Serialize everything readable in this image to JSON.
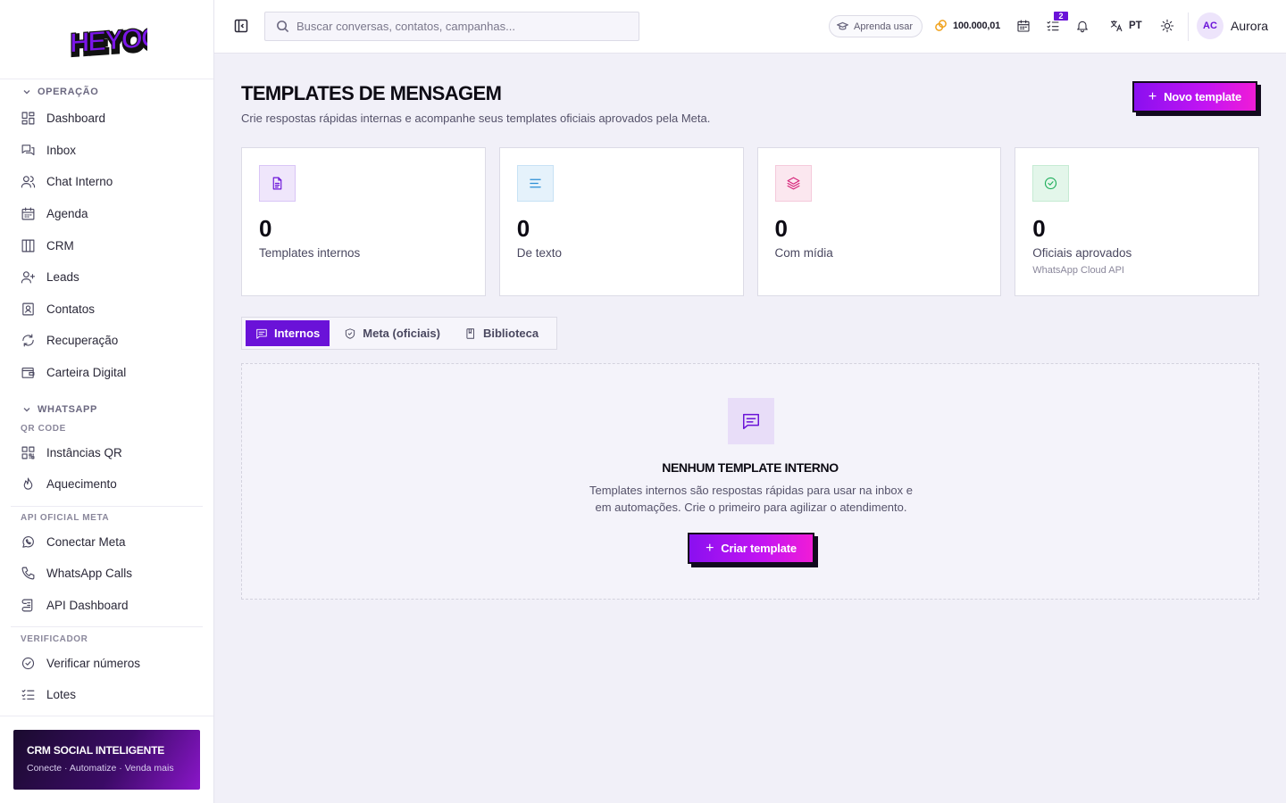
{
  "sidebar": {
    "logo_text": "HEYOO",
    "groups": [
      {
        "label": "OPERAÇÃO",
        "items": [
          {
            "label": "Dashboard",
            "icon": "dashboard-icon"
          },
          {
            "label": "Inbox",
            "icon": "inbox-icon"
          },
          {
            "label": "Chat Interno",
            "icon": "users-icon"
          },
          {
            "label": "Agenda",
            "icon": "calendar-icon"
          },
          {
            "label": "CRM",
            "icon": "columns-icon"
          },
          {
            "label": "Leads",
            "icon": "user-plus-icon"
          },
          {
            "label": "Contatos",
            "icon": "contact-icon"
          },
          {
            "label": "Recuperação",
            "icon": "refresh-icon"
          },
          {
            "label": "Carteira Digital",
            "icon": "wallet-icon"
          }
        ]
      },
      {
        "label": "WHATSAPP"
      }
    ],
    "qr_head": "QR CODE",
    "qr_items": [
      {
        "label": "Instâncias QR",
        "icon": "qr-icon"
      },
      {
        "label": "Aquecimento",
        "icon": "flame-icon"
      }
    ],
    "meta_head": "API OFICIAL META",
    "meta_items": [
      {
        "label": "Conectar Meta",
        "icon": "whatsapp-icon"
      },
      {
        "label": "WhatsApp Calls",
        "icon": "phone-icon"
      },
      {
        "label": "API Dashboard",
        "icon": "scroll-icon"
      }
    ],
    "verif_head": "VERIFICADOR",
    "verif_items": [
      {
        "label": "Verificar números",
        "icon": "check-circle-icon"
      },
      {
        "label": "Lotes",
        "icon": "list-check-icon"
      }
    ],
    "promo": {
      "title": "CRM SOCIAL INTELIGENTE",
      "subtitle": "Conecte · Automatize · Venda mais"
    }
  },
  "topbar": {
    "search_placeholder": "Buscar conversas, contatos, campanhas...",
    "learn_label": "Aprenda usar",
    "credits": "100.000,01",
    "tasks_badge": "2",
    "language": "PT",
    "avatar_initials": "AC",
    "username": "Aurora"
  },
  "page": {
    "title": "TEMPLATES DE MENSAGEM",
    "subtitle": "Crie respostas rápidas internas e acompanhe seus templates oficiais aprovados pela Meta.",
    "new_button": "Novo template"
  },
  "stats": [
    {
      "value": "0",
      "label": "Templates internos",
      "note": "",
      "icon": "file-text-icon",
      "color": "#6a12d8",
      "bg": "#efe6fb"
    },
    {
      "value": "0",
      "label": "De texto",
      "note": "",
      "icon": "align-left-icon",
      "color": "#2b8fd6",
      "bg": "#e5f2fb"
    },
    {
      "value": "0",
      "label": "Com mídia",
      "note": "",
      "icon": "layers-icon",
      "color": "#d6247a",
      "bg": "#fbe7ef"
    },
    {
      "value": "0",
      "label": "Oficiais aprovados",
      "note": "WhatsApp Cloud API",
      "icon": "check-circle-icon",
      "color": "#1fae5b",
      "bg": "#e3f6ea"
    }
  ],
  "tabs": [
    {
      "label": "Internos",
      "icon": "message-icon",
      "active": true
    },
    {
      "label": "Meta (oficiais)",
      "icon": "shield-check-icon",
      "active": false
    },
    {
      "label": "Biblioteca",
      "icon": "book-icon",
      "active": false
    }
  ],
  "empty": {
    "title": "NENHUM TEMPLATE INTERNO",
    "description": "Templates internos são respostas rápidas para usar na inbox e em automações. Crie o primeiro para agilizar o atendimento.",
    "button": "Criar template"
  },
  "colors": {
    "accent": "#6a12d8",
    "gradient_start": "#8a10f0",
    "gradient_end": "#f01cd6"
  }
}
